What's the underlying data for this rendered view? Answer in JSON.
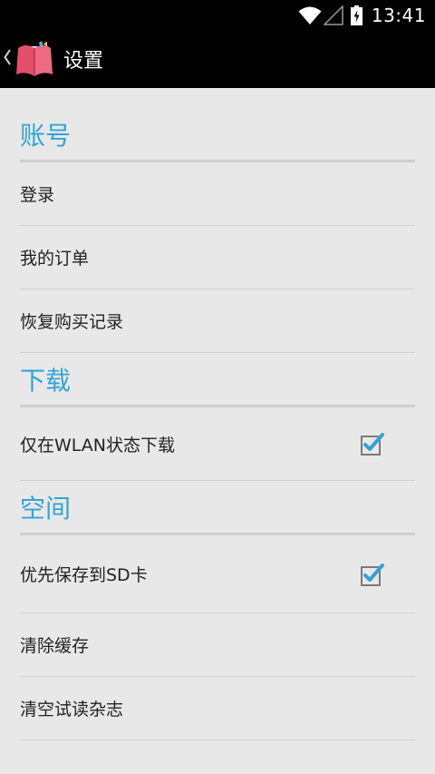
{
  "status_bar": {
    "time": "13:41",
    "icons": [
      "wifi-icon",
      "signal-icon",
      "battery-charging-icon"
    ]
  },
  "action_bar": {
    "title": "设置",
    "icons": [
      "up-chevron-icon",
      "book-logo-icon"
    ]
  },
  "sections": [
    {
      "title": "账号",
      "items": [
        {
          "label": "登录"
        },
        {
          "label": "我的订单"
        },
        {
          "label": "恢复购买记录"
        }
      ]
    },
    {
      "title": "下载",
      "items": [
        {
          "label": "仅在WLAN状态下载",
          "checked": true
        }
      ]
    },
    {
      "title": "空间",
      "items": [
        {
          "label": "优先保存到SD卡",
          "checked": true
        },
        {
          "label": "清除缓存"
        },
        {
          "label": "清空试读杂志"
        }
      ]
    }
  ],
  "colors": {
    "accent": "#33a3d4",
    "background": "#e8e8e8",
    "bar": "#000000",
    "divider": "#d0d0d0",
    "section_divider": "#cfcfcf"
  }
}
